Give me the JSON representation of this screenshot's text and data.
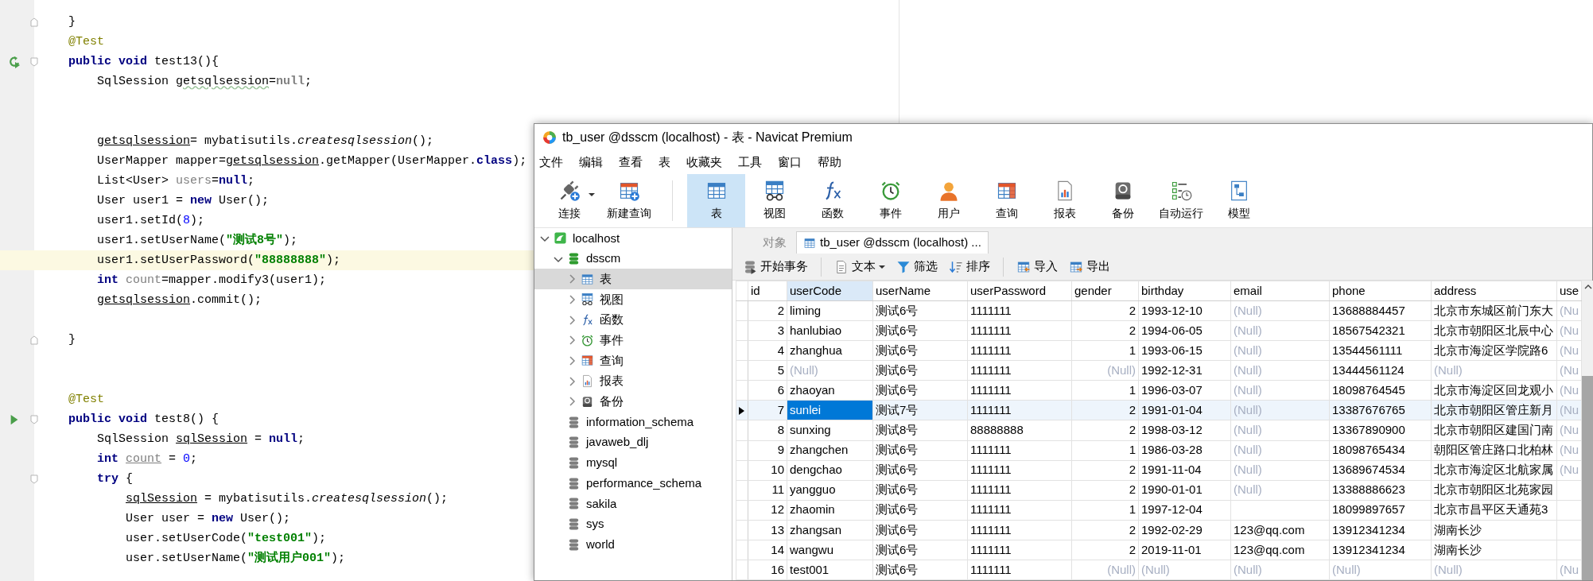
{
  "editor": {
    "lines": [
      {
        "kind": "code",
        "fold_end": true,
        "tokens": [
          {
            "kind": "plain",
            "text": "}"
          }
        ]
      },
      {
        "kind": "code",
        "tokens": [
          {
            "kind": "ann",
            "text": "@Test"
          }
        ]
      },
      {
        "kind": "code",
        "rerun": true,
        "fold_start": true,
        "tokens": [
          {
            "kind": "kw",
            "text": "public void"
          },
          {
            "kind": "plain",
            "text": " test13(){"
          }
        ],
        "children": [
          {
            "kind": "code",
            "tokens": [
              {
                "kind": "plain",
                "text": "SqlSession "
              },
              {
                "kind": "wavy",
                "text": "getsqlsession"
              },
              {
                "kind": "plain",
                "text": "="
              },
              {
                "kind": "dimkw",
                "text": "null"
              },
              {
                "kind": "plain",
                "text": ";"
              }
            ]
          },
          {
            "kind": "blank"
          },
          {
            "kind": "blank"
          },
          {
            "kind": "code",
            "tokens": [
              {
                "kind": "ul",
                "text": "getsqlsession"
              },
              {
                "kind": "plain",
                "text": "= mybatisutils."
              },
              {
                "kind": "it",
                "text": "createsqlsession"
              },
              {
                "kind": "plain",
                "text": "();"
              }
            ]
          },
          {
            "kind": "code",
            "tokens": [
              {
                "kind": "plain",
                "text": "UserMapper mapper="
              },
              {
                "kind": "ul",
                "text": "getsqlsession"
              },
              {
                "kind": "plain",
                "text": ".getMapper(UserMapper."
              },
              {
                "kind": "kw",
                "text": "class"
              },
              {
                "kind": "plain",
                "text": ");"
              }
            ]
          },
          {
            "kind": "code",
            "tokens": [
              {
                "kind": "plain",
                "text": "List<User> "
              },
              {
                "kind": "dim",
                "text": "users"
              },
              {
                "kind": "plain",
                "text": "="
              },
              {
                "kind": "kw",
                "text": "null"
              },
              {
                "kind": "plain",
                "text": ";"
              }
            ]
          },
          {
            "kind": "code",
            "tokens": [
              {
                "kind": "plain",
                "text": "User user1 = "
              },
              {
                "kind": "kw",
                "text": "new"
              },
              {
                "kind": "plain",
                "text": " User();"
              }
            ]
          },
          {
            "kind": "code",
            "tokens": [
              {
                "kind": "plain",
                "text": "user1.setId("
              },
              {
                "kind": "num",
                "text": "8"
              },
              {
                "kind": "plain",
                "text": ");"
              }
            ]
          },
          {
            "kind": "code",
            "tokens": [
              {
                "kind": "plain",
                "text": "user1.setUserName("
              },
              {
                "kind": "str",
                "text": "\"测试8号\""
              },
              {
                "kind": "plain",
                "text": ");"
              }
            ]
          },
          {
            "kind": "code",
            "current": true,
            "tokens": [
              {
                "kind": "plain",
                "text": "user1.setUserPassword("
              },
              {
                "kind": "str",
                "text": "\"88888888\""
              },
              {
                "kind": "plain",
                "text": ");"
              }
            ]
          },
          {
            "kind": "code",
            "tokens": [
              {
                "kind": "kw",
                "text": "int"
              },
              {
                "kind": "dim",
                "text": " count"
              },
              {
                "kind": "plain",
                "text": "=mapper.modify3(user1);"
              }
            ]
          },
          {
            "kind": "code",
            "tokens": [
              {
                "kind": "ul",
                "text": "getsqlsession"
              },
              {
                "kind": "plain",
                "text": ".commit();"
              }
            ]
          },
          {
            "kind": "blank"
          }
        ]
      },
      {
        "kind": "code",
        "fold_end": true,
        "tokens": [
          {
            "kind": "plain",
            "text": "}"
          }
        ]
      },
      {
        "kind": "blank"
      },
      {
        "kind": "blank"
      },
      {
        "kind": "code",
        "tokens": [
          {
            "kind": "ann",
            "text": "@Test"
          }
        ]
      },
      {
        "kind": "code",
        "run": true,
        "fold_start": true,
        "tokens": [
          {
            "kind": "kw",
            "text": "public void"
          },
          {
            "kind": "plain",
            "text": " test8() {"
          }
        ],
        "children": [
          {
            "kind": "code",
            "tokens": [
              {
                "kind": "plain",
                "text": "SqlSession "
              },
              {
                "kind": "ul",
                "text": "sqlSession"
              },
              {
                "kind": "plain",
                "text": " = "
              },
              {
                "kind": "kw",
                "text": "null"
              },
              {
                "kind": "plain",
                "text": ";"
              }
            ]
          },
          {
            "kind": "code",
            "tokens": [
              {
                "kind": "kw",
                "text": "int "
              },
              {
                "kind": "dimul",
                "text": "count"
              },
              {
                "kind": "plain",
                "text": " = "
              },
              {
                "kind": "num",
                "text": "0"
              },
              {
                "kind": "plain",
                "text": ";"
              }
            ]
          },
          {
            "kind": "code",
            "fold_start": true,
            "tokens": [
              {
                "kind": "kw",
                "text": "try"
              },
              {
                "kind": "plain",
                "text": " {"
              }
            ],
            "children": [
              {
                "kind": "code",
                "tokens": [
                  {
                    "kind": "ul",
                    "text": "sqlSession"
                  },
                  {
                    "kind": "plain",
                    "text": " = mybatisutils."
                  },
                  {
                    "kind": "it",
                    "text": "createsqlsession"
                  },
                  {
                    "kind": "plain",
                    "text": "();"
                  }
                ]
              },
              {
                "kind": "code",
                "tokens": [
                  {
                    "kind": "plain",
                    "text": "User user = "
                  },
                  {
                    "kind": "kw",
                    "text": "new"
                  },
                  {
                    "kind": "plain",
                    "text": " User();"
                  }
                ]
              },
              {
                "kind": "code",
                "tokens": [
                  {
                    "kind": "plain",
                    "text": "user.setUserCode("
                  },
                  {
                    "kind": "str",
                    "text": "\"test001\""
                  },
                  {
                    "kind": "plain",
                    "text": ");"
                  }
                ]
              },
              {
                "kind": "code",
                "tokens": [
                  {
                    "kind": "plain",
                    "text": "user.setUserName("
                  },
                  {
                    "kind": "str",
                    "text": "\"测试用户001\""
                  },
                  {
                    "kind": "plain",
                    "text": ");"
                  }
                ]
              }
            ]
          }
        ]
      }
    ]
  },
  "navicat": {
    "title": "tb_user @dsscm (localhost) - 表 - Navicat Premium",
    "menu": [
      "文件",
      "编辑",
      "查看",
      "表",
      "收藏夹",
      "工具",
      "窗口",
      "帮助"
    ],
    "toolbar": [
      {
        "label": "连接",
        "kind": "connect",
        "dropdown": true,
        "selected": false
      },
      {
        "label": "新建查询",
        "kind": "new-query",
        "selected": false
      },
      {
        "label": "表",
        "kind": "table",
        "separator_before": true,
        "selected": true
      },
      {
        "label": "视图",
        "kind": "view",
        "selected": false
      },
      {
        "label": "函数",
        "kind": "function",
        "selected": false
      },
      {
        "label": "事件",
        "kind": "event",
        "selected": false
      },
      {
        "label": "用户",
        "kind": "user",
        "selected": false
      },
      {
        "label": "查询",
        "kind": "query",
        "selected": false
      },
      {
        "label": "报表",
        "kind": "report",
        "selected": false
      },
      {
        "label": "备份",
        "kind": "backup",
        "selected": false
      },
      {
        "label": "自动运行",
        "kind": "automation",
        "selected": false
      },
      {
        "label": "模型",
        "kind": "model",
        "selected": false
      }
    ],
    "tree": [
      {
        "label": "localhost",
        "kind": "connection",
        "expanded": true,
        "selected": false,
        "children": [
          {
            "label": "dsscm",
            "kind": "database",
            "open": true,
            "expanded": true,
            "selected": false,
            "children": [
              {
                "label": "表",
                "kind": "table",
                "expanded": false,
                "selected": true
              },
              {
                "label": "视图",
                "kind": "view",
                "expanded": false,
                "selected": false
              },
              {
                "label": "函数",
                "kind": "function",
                "expanded": false,
                "selected": false
              },
              {
                "label": "事件",
                "kind": "event",
                "expanded": false,
                "selected": false
              },
              {
                "label": "查询",
                "kind": "query",
                "expanded": false,
                "selected": false
              },
              {
                "label": "报表",
                "kind": "report",
                "expanded": false,
                "selected": false
              },
              {
                "label": "备份",
                "kind": "backup",
                "expanded": false,
                "selected": false
              }
            ]
          },
          {
            "label": "information_schema",
            "kind": "database",
            "open": false,
            "selected": false
          },
          {
            "label": "javaweb_dlj",
            "kind": "database",
            "open": false,
            "selected": false
          },
          {
            "label": "mysql",
            "kind": "database",
            "open": false,
            "selected": false
          },
          {
            "label": "performance_schema",
            "kind": "database",
            "open": false,
            "selected": false
          },
          {
            "label": "sakila",
            "kind": "database",
            "open": false,
            "selected": false
          },
          {
            "label": "sys",
            "kind": "database",
            "open": false,
            "selected": false
          },
          {
            "label": "world",
            "kind": "database",
            "open": false,
            "selected": false
          }
        ]
      }
    ],
    "tabs": [
      {
        "label": "对象",
        "kind": "objects",
        "selected": false
      },
      {
        "label": "tb_user @dsscm (localhost) ...",
        "kind": "table",
        "selected": true
      }
    ],
    "actions": [
      {
        "label": "开始事务",
        "kind": "transaction"
      },
      {
        "label": "文本",
        "kind": "text",
        "dropdown": true,
        "separator_before": true
      },
      {
        "label": "筛选",
        "kind": "filter"
      },
      {
        "label": "排序",
        "kind": "sort"
      },
      {
        "label": "导入",
        "kind": "import",
        "separator_before": true
      },
      {
        "label": "导出",
        "kind": "export"
      }
    ],
    "grid": {
      "columns": [
        {
          "label": "id",
          "numeric": true,
          "selected": false
        },
        {
          "label": "userCode",
          "selected": true
        },
        {
          "label": "userName",
          "selected": false
        },
        {
          "label": "userPassword",
          "selected": false
        },
        {
          "label": "gender",
          "numeric": true,
          "selected": false
        },
        {
          "label": "birthday",
          "selected": false
        },
        {
          "label": "email",
          "selected": false
        },
        {
          "label": "phone",
          "selected": false
        },
        {
          "label": "address",
          "selected": false
        },
        {
          "label": "use",
          "selected": false
        }
      ],
      "rows": [
        {
          "selected": false,
          "cells": [
            "2",
            "liming",
            "测试6号",
            "1111111",
            "2",
            "1993-12-10",
            {
              "text": "(Null)",
              "null": true
            },
            "13688884457",
            "北京市东城区前门东大",
            {
              "text": "(Nu",
              "null": true
            }
          ]
        },
        {
          "selected": false,
          "cells": [
            "3",
            "hanlubiao",
            "测试6号",
            "1111111",
            "2",
            "1994-06-05",
            {
              "text": "(Null)",
              "null": true
            },
            "18567542321",
            "北京市朝阳区北辰中心",
            {
              "text": "(Nu",
              "null": true
            }
          ]
        },
        {
          "selected": false,
          "cells": [
            "4",
            "zhanghua",
            "测试6号",
            "1111111",
            "1",
            "1993-06-15",
            {
              "text": "(Null)",
              "null": true
            },
            "13544561111",
            "北京市海淀区学院路6",
            {
              "text": "(Nu",
              "null": true
            }
          ]
        },
        {
          "selected": false,
          "cells": [
            "5",
            {
              "text": "(Null)",
              "null": true
            },
            "测试6号",
            "1111111",
            {
              "text": "(Null)",
              "null": true
            },
            "1992-12-31",
            {
              "text": "(Null)",
              "null": true
            },
            "13444561124",
            {
              "text": "(Null)",
              "null": true
            },
            {
              "text": "(Nu",
              "null": true
            }
          ]
        },
        {
          "selected": false,
          "cells": [
            "6",
            "zhaoyan",
            "测试6号",
            "1111111",
            "1",
            "1996-03-07",
            {
              "text": "(Null)",
              "null": true
            },
            "18098764545",
            "北京市海淀区回龙观小",
            {
              "text": "(Nu",
              "null": true
            }
          ]
        },
        {
          "selected": true,
          "cells": [
            "7",
            {
              "text": "sunlei",
              "selected": true
            },
            "测试7号",
            "1111111",
            "2",
            "1991-01-04",
            {
              "text": "(Null)",
              "null": true
            },
            "13387676765",
            "北京市朝阳区管庄新月",
            {
              "text": "(Nu",
              "null": true
            }
          ]
        },
        {
          "selected": false,
          "cells": [
            "8",
            "sunxing",
            "测试8号",
            "88888888",
            "2",
            "1998-03-12",
            {
              "text": "(Null)",
              "null": true
            },
            "13367890900",
            "北京市朝阳区建国门南",
            {
              "text": "(Nu",
              "null": true
            }
          ]
        },
        {
          "selected": false,
          "cells": [
            "9",
            "zhangchen",
            "测试6号",
            "1111111",
            "1",
            "1986-03-28",
            {
              "text": "(Null)",
              "null": true
            },
            "18098765434",
            "朝阳区管庄路口北柏林",
            {
              "text": "(Nu",
              "null": true
            }
          ]
        },
        {
          "selected": false,
          "cells": [
            "10",
            "dengchao",
            "测试6号",
            "1111111",
            "2",
            "1991-11-04",
            {
              "text": "(Null)",
              "null": true
            },
            "13689674534",
            "北京市海淀区北航家属",
            {
              "text": "(Nu",
              "null": true
            }
          ]
        },
        {
          "selected": false,
          "cells": [
            "11",
            "yangguo",
            "测试6号",
            "1111111",
            "2",
            "1990-01-01",
            {
              "text": "(Null)",
              "null": true
            },
            "13388886623",
            "北京市朝阳区北苑家园"
          ]
        },
        {
          "selected": false,
          "cells": [
            "12",
            "zhaomin",
            "测试6号",
            "1111111",
            "1",
            "1997-12-04",
            null,
            "18099897657",
            "北京市昌平区天通苑3"
          ]
        },
        {
          "selected": false,
          "cells": [
            "13",
            "zhangsan",
            "测试6号",
            "1111111",
            "2",
            "1992-02-29",
            "123@qq.com",
            "13912341234",
            "湖南长沙"
          ]
        },
        {
          "selected": false,
          "cells": [
            "14",
            "wangwu",
            "测试6号",
            "1111111",
            "2",
            "2019-11-01",
            "123@qq.com",
            "13912341234",
            "湖南长沙"
          ]
        },
        {
          "selected": false,
          "cells": [
            "16",
            "test001",
            "测试6号",
            "1111111",
            {
              "text": "(Null)",
              "null": true
            },
            {
              "text": "(Null)",
              "null": true
            },
            {
              "text": "(Null)",
              "null": true
            },
            {
              "text": "(Null)",
              "null": true
            },
            {
              "text": "(Null)",
              "null": true
            },
            {
              "text": "(Nu",
              "null": true
            }
          ]
        }
      ]
    }
  }
}
